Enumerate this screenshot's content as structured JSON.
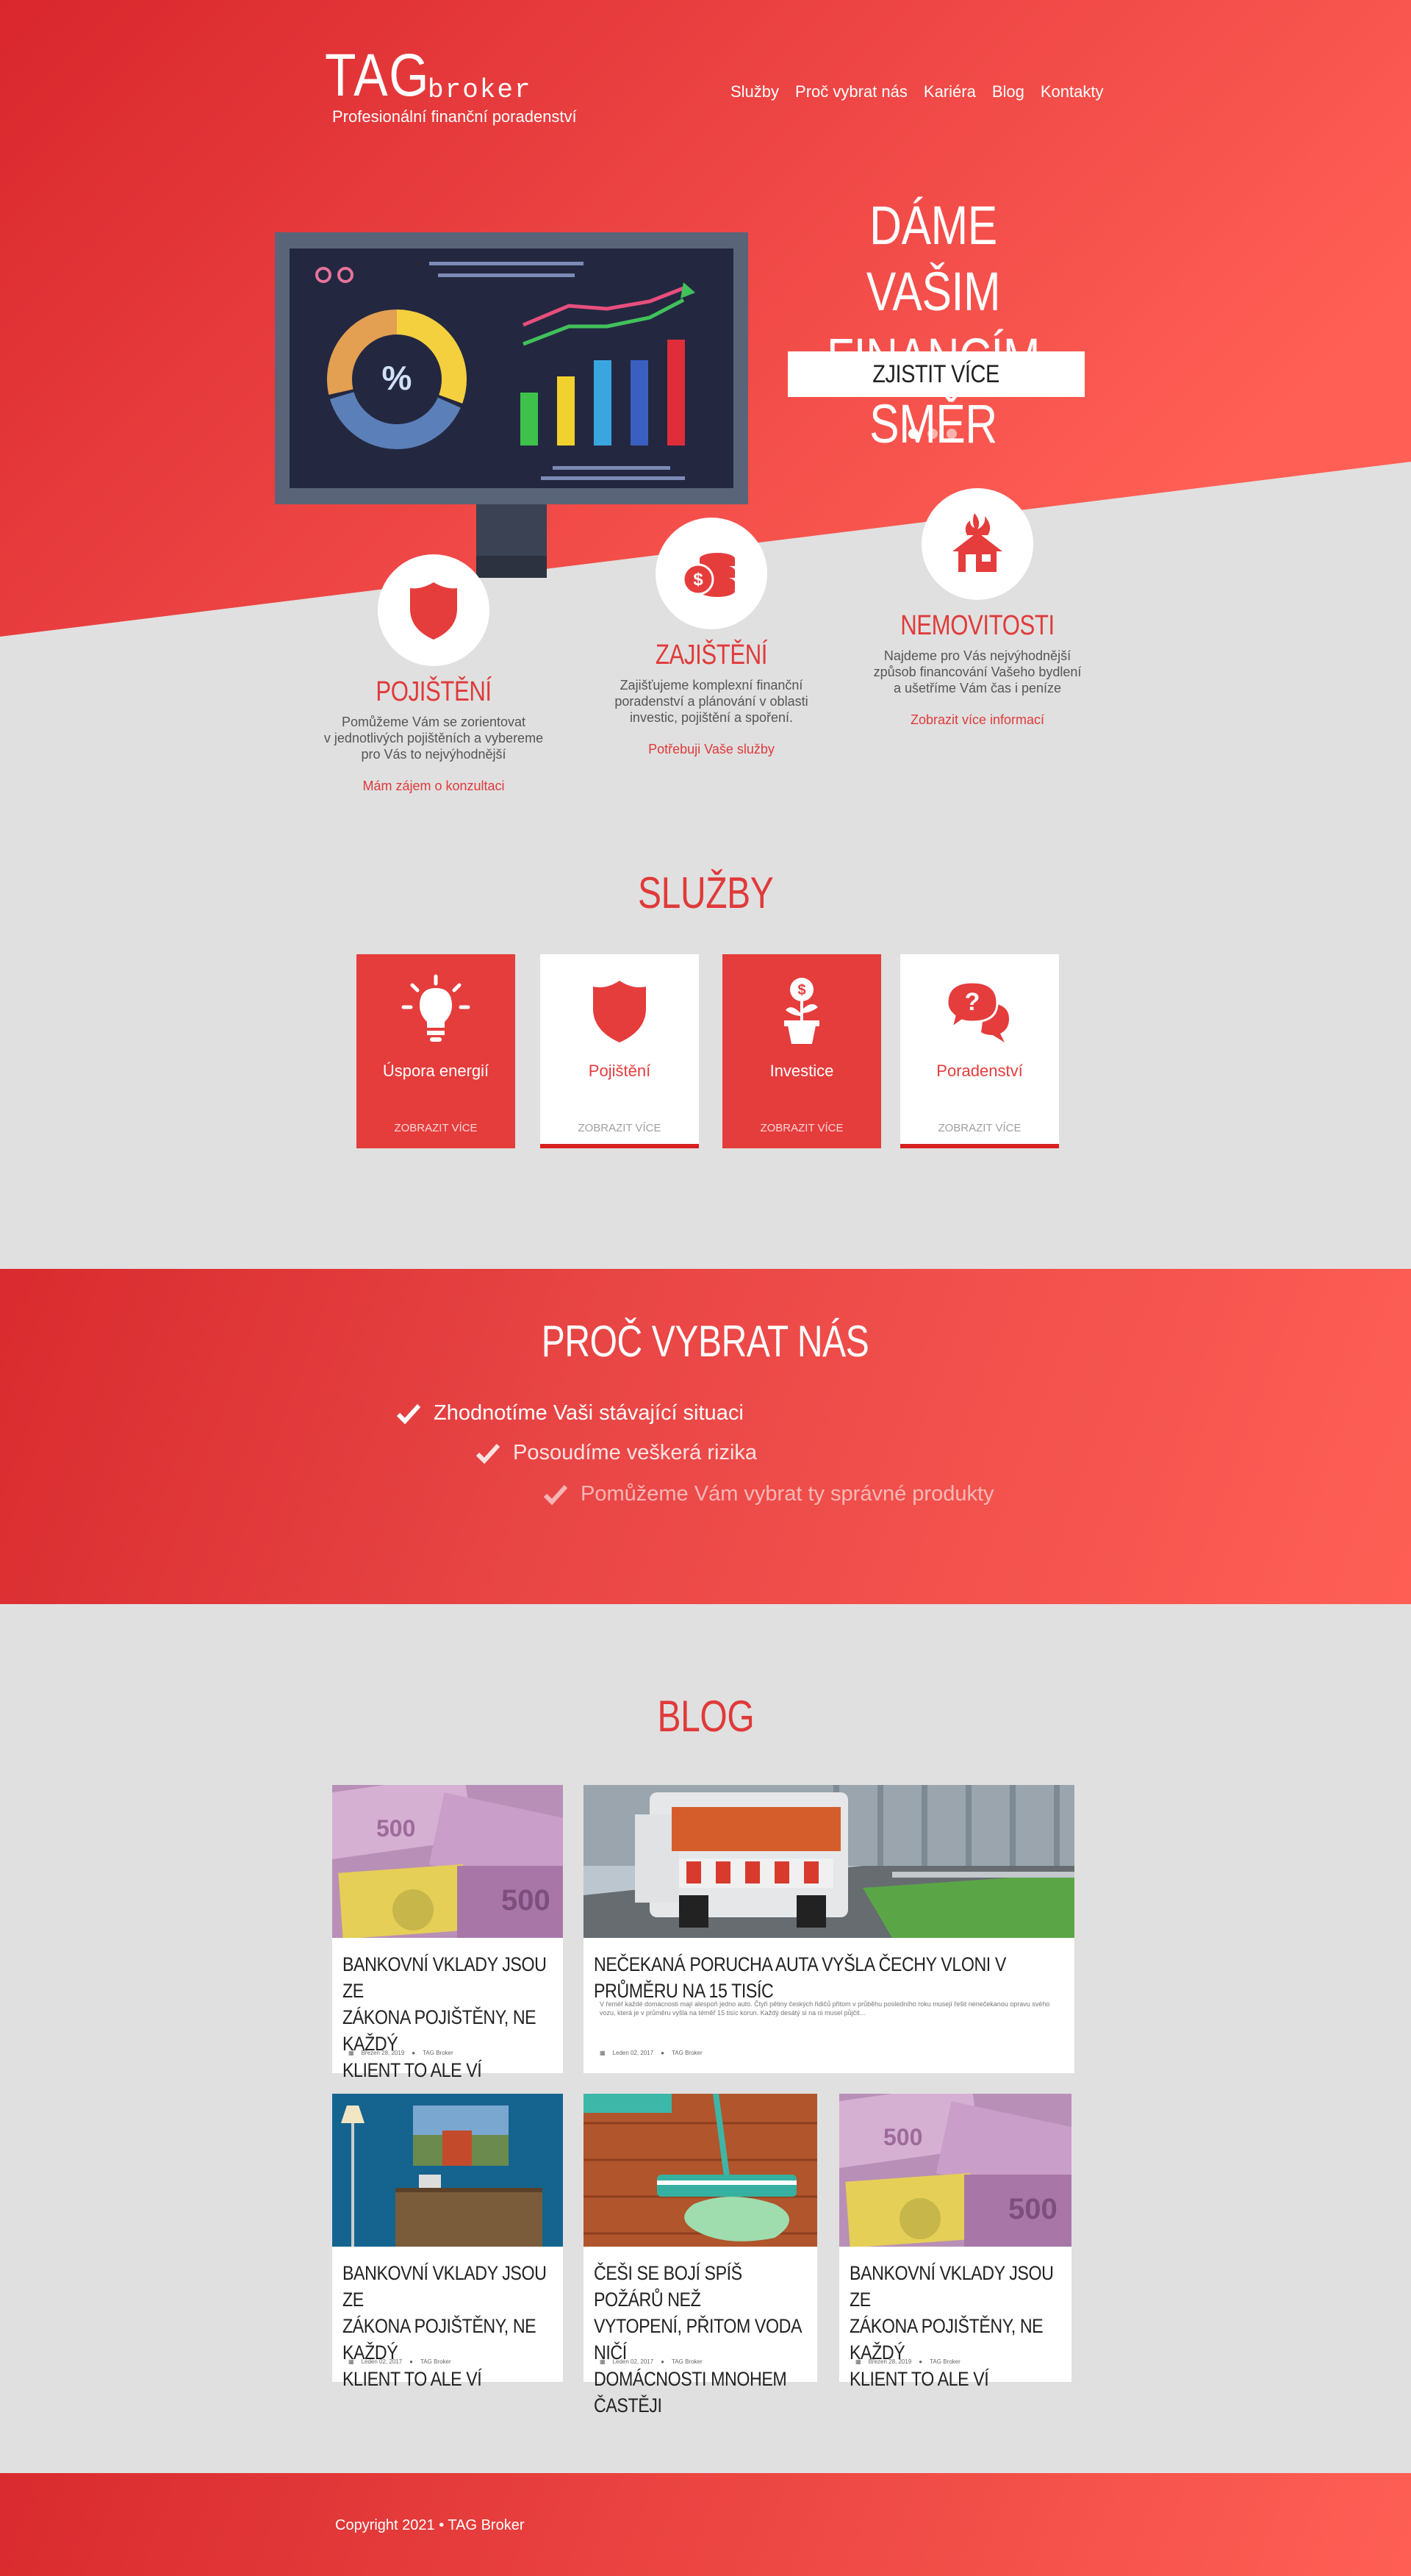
{
  "brand": {
    "logo_main": "TAG",
    "logo_sub": "broker",
    "tagline": "Profesionální finanční poradenství"
  },
  "nav": [
    "Služby",
    "Proč vybrat nás",
    "Kariéra",
    "Blog",
    "Kontakty"
  ],
  "hero": {
    "title_line1": "DÁME VAŠIM",
    "title_line2": "FINANCÍM SMĚR",
    "cta": "ZJISTIT VÍCE",
    "monitor_percent": "%"
  },
  "features": [
    {
      "title": "POJIŠTĚNÍ",
      "text_1": "Pomůžeme Vám se zorientovat",
      "text_2": "v jednotlivých pojištěních a vybereme",
      "text_3": "pro Vás to nejvýhodnější",
      "link": "Mám zájem o konzultaci"
    },
    {
      "title": "ZAJIŠTĚNÍ",
      "text_1": "Zajišťujeme komplexní finanční",
      "text_2": "poradenství a plánování v oblasti",
      "text_3": "investic, pojištění a spoření.",
      "link": "Potřebuji Vaše služby"
    },
    {
      "title": "NEMOVITOSTI",
      "text_1": "Najdeme pro Vás nejvýhodnější",
      "text_2": "způsob financování Vašeho bydlení",
      "text_3": "a ušetříme Vám čas i peníze",
      "link": "Zobrazit více informací"
    }
  ],
  "services": {
    "title": "SLUŽBY",
    "items": [
      {
        "label": "Úspora energií",
        "more": "ZOBRAZIT VÍCE",
        "icon": "lightbulb-icon"
      },
      {
        "label": "Pojištění",
        "more": "ZOBRAZIT VÍCE",
        "icon": "shield-icon"
      },
      {
        "label": "Investice",
        "more": "ZOBRAZIT VÍCE",
        "icon": "money-plant-icon"
      },
      {
        "label": "Poradenství",
        "more": "ZOBRAZIT VÍCE",
        "icon": "question-chat-icon"
      }
    ]
  },
  "why": {
    "title": "PROČ VYBRAT NÁS",
    "items": [
      "Zhodnotíme Vaši stávající situaci",
      "Posoudíme veškerá rizika",
      "Pomůžeme Vám vybrat ty správné produkty"
    ]
  },
  "blog": {
    "title": "BLOG",
    "posts": [
      {
        "title_1": "BANKOVNÍ VKLADY JSOU ZE",
        "title_2": "ZÁKONA POJIŠTĚNY, NE KAŽDÝ",
        "title_3": "KLIENT TO ALE VÍ",
        "date": "Březen 28, 2019",
        "author": "TAG Broker"
      },
      {
        "title_1": "NEČEKANÁ PORUCHA AUTA VYŠLA ČECHY VLONI V PRŮMĚRU NA 15 TISÍC",
        "excerpt": "V řeméř každé domácnosti mají alespoň jedno auto. Čtyři pětiny českých řidičů přitom v průběhu posledního roku musejí řešit nenečekanou opravu svého vozu, která je v průměru vyšla na téměř 15 tisíc korun. Každý desátý si na ni musel půjčit…",
        "date": "Leden 02, 2017",
        "author": "TAG Broker"
      },
      {
        "title_1": "BANKOVNÍ VKLADY JSOU ZE",
        "title_2": "ZÁKONA POJIŠTĚNY, NE KAŽDÝ",
        "title_3": "KLIENT TO ALE VÍ",
        "date": "Leden 02, 2017",
        "author": "TAG Broker"
      },
      {
        "title_1": "ČEŠI SE BOJÍ SPÍŠ POŽÁRŮ NEŽ",
        "title_2": "VYTOPENÍ, PŘITOM VODA NIČÍ",
        "title_3": "DOMÁCNOSTI MNOHEM ČASTĚJI",
        "date": "Leden 02, 2017",
        "author": "TAG Broker"
      },
      {
        "title_1": "BANKOVNÍ VKLADY JSOU ZE",
        "title_2": "ZÁKONA POJIŠTĚNY, NE KAŽDÝ",
        "title_3": "KLIENT TO ALE VÍ",
        "date": "Březen 28, 2019",
        "author": "TAG Broker"
      }
    ]
  },
  "footer": {
    "copyright": "Copyright 2021 • TAG Broker"
  },
  "colors": {
    "brand_red": "#e53c3c",
    "light_red": "#fe5f55",
    "background": "#e0e0e0"
  }
}
